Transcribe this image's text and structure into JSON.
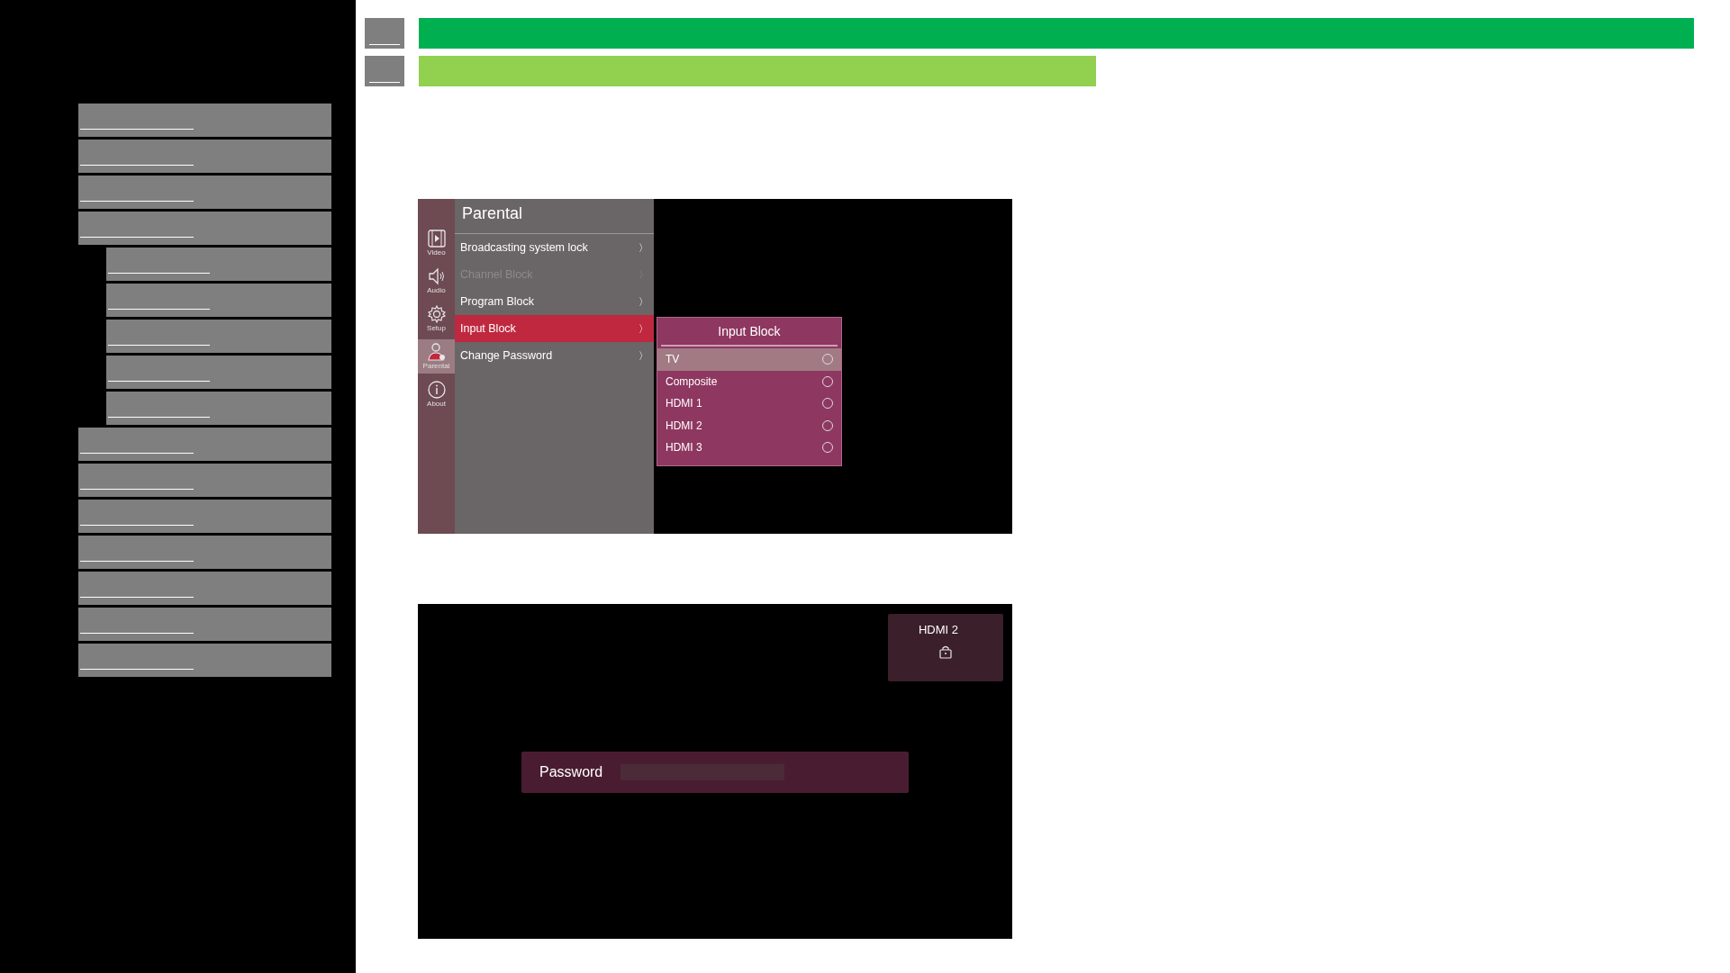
{
  "header": {
    "bars": [
      {
        "color": "#00b050"
      },
      {
        "color": "#92d050"
      }
    ]
  },
  "sidebar": {
    "items": [
      {
        "kind": "link"
      },
      {
        "kind": "link"
      },
      {
        "kind": "link"
      },
      {
        "kind": "link",
        "children": [
          {
            "kind": "link"
          },
          {
            "kind": "link"
          },
          {
            "kind": "link"
          },
          {
            "kind": "link"
          },
          {
            "kind": "link"
          }
        ]
      },
      {
        "kind": "link"
      },
      {
        "kind": "link"
      },
      {
        "kind": "link"
      },
      {
        "kind": "link"
      },
      {
        "kind": "link"
      },
      {
        "kind": "link"
      },
      {
        "kind": "link"
      }
    ]
  },
  "tv_menu": {
    "rail": [
      {
        "kind": "video",
        "label": "Video",
        "selected": false
      },
      {
        "kind": "audio",
        "label": "Audio",
        "selected": false
      },
      {
        "kind": "setup",
        "label": "Setup",
        "selected": false
      },
      {
        "kind": "parental",
        "label": "Parental",
        "selected": true
      },
      {
        "kind": "about",
        "label": "About",
        "selected": false
      }
    ],
    "title": "Parental",
    "items": [
      {
        "label": "Broadcasting system lock",
        "arrow": "〉",
        "selected": false,
        "disabled": false
      },
      {
        "label": "Channel Block",
        "arrow": "〉",
        "selected": false,
        "disabled": true
      },
      {
        "label": "Program Block",
        "arrow": "〉",
        "selected": false,
        "disabled": false
      },
      {
        "label": "Input Block",
        "arrow": "〉",
        "selected": true,
        "disabled": false
      },
      {
        "label": "Change Password",
        "arrow": "〉",
        "selected": false,
        "disabled": false
      }
    ],
    "popup": {
      "title": "Input Block",
      "options": [
        {
          "label": "TV",
          "selected": true,
          "checked": false
        },
        {
          "label": "Composite",
          "selected": false,
          "checked": false
        },
        {
          "label": "HDMI 1",
          "selected": false,
          "checked": false
        },
        {
          "label": "HDMI 2",
          "selected": false,
          "checked": false
        },
        {
          "label": "HDMI 3",
          "selected": false,
          "checked": false
        }
      ]
    }
  },
  "tv_lock": {
    "source": "HDMI 2",
    "password_label": "Password"
  }
}
